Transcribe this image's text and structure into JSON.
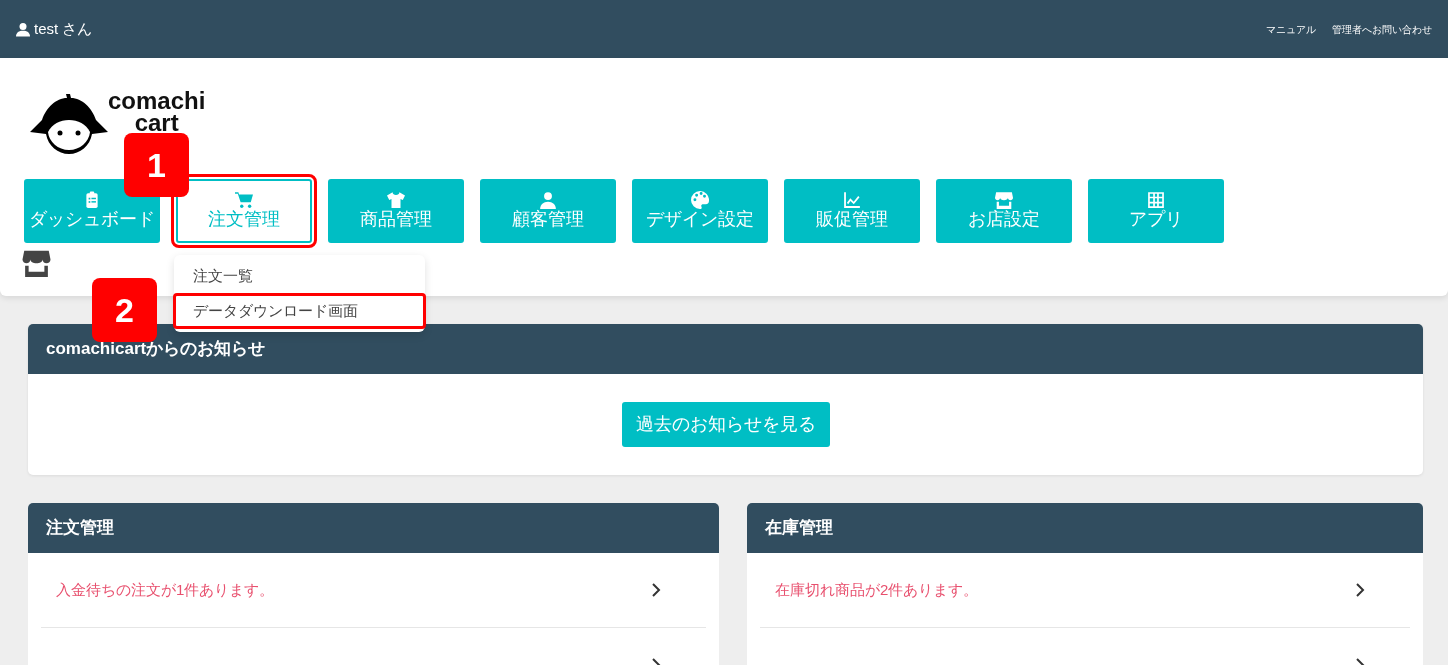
{
  "top_bar": {
    "user": "test さん",
    "links": [
      "マニュアル",
      "管理者へお問い合わせ"
    ]
  },
  "logo": {
    "line_1": "comachi",
    "line_2": "cart"
  },
  "nav": [
    {
      "label": "ダッシュボード",
      "kind": "clipboard",
      "selected": false,
      "annotated": false
    },
    {
      "label": "注文管理",
      "kind": "cart",
      "selected": true,
      "annotated": true
    },
    {
      "label": "商品管理",
      "kind": "shirt",
      "selected": false,
      "annotated": false
    },
    {
      "label": "顧客管理",
      "kind": "person",
      "selected": false,
      "annotated": false
    },
    {
      "label": "デザイン設定",
      "kind": "palette",
      "selected": false,
      "annotated": false
    },
    {
      "label": "販促管理",
      "kind": "chart",
      "selected": false,
      "annotated": false
    },
    {
      "label": "お店設定",
      "kind": "store",
      "selected": false,
      "annotated": false
    },
    {
      "label": "アプリ",
      "kind": "grid",
      "selected": false,
      "annotated": false
    }
  ],
  "dropdown": [
    {
      "label": "注文一覧",
      "annotated": false
    },
    {
      "label": "データダウンロード画面",
      "annotated": true
    }
  ],
  "annotations": [
    {
      "number": "1"
    },
    {
      "number": "2"
    }
  ],
  "notice": {
    "title": "comachicartからのお知らせ",
    "button": "過去のお知らせを見る"
  },
  "panels": [
    {
      "title": "注文管理",
      "rows": [
        {
          "text": "入金待ちの注文が1件あります。"
        },
        {}
      ]
    },
    {
      "title": "在庫管理",
      "rows": [
        {
          "text": "在庫切れ商品が2件あります。"
        },
        {}
      ]
    }
  ]
}
